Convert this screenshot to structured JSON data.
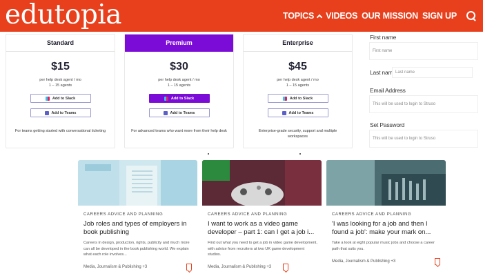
{
  "header": {
    "logo": "edutopia",
    "nav": {
      "topics": "TOPICS",
      "videos": "VIDEOS",
      "mission": "OUR MISSION",
      "signup": "SIGN UP"
    },
    "bg_color": "#e8401c"
  },
  "pricing": [
    {
      "name": "Standard",
      "price": "$15",
      "unit": "per help desk agent / mo",
      "agents": "1 – 15 agents",
      "slack": "Add to Slack",
      "teams": "Add to Teams",
      "desc": "For teams getting started with conversational ticketing"
    },
    {
      "name": "Premium",
      "price": "$30",
      "unit": "per help desk agent / mo",
      "agents": "1 – 15 agents",
      "slack": "Add to Slack",
      "teams": "Add to Teams",
      "desc": "For advanced teams who want more from their help desk"
    },
    {
      "name": "Enterprise",
      "price": "$45",
      "unit": "per help desk agent / mo",
      "agents": "1 – 15 agents",
      "slack": "Add to Slack",
      "teams": "Add to Teams",
      "desc": "Enterprise-grade security, support and multiple workspaces"
    }
  ],
  "form": {
    "first_name": {
      "label": "First name",
      "placeholder": "First name"
    },
    "last_name": {
      "label": "Last name",
      "placeholder": "Last name"
    },
    "email": {
      "label": "Email Address",
      "placeholder": "This will be used to login to Struso"
    },
    "password": {
      "label": "Set Password",
      "placeholder": "This will be used to login to Struso"
    }
  },
  "articles": [
    {
      "category": "CAREERS ADVICE AND PLANNING",
      "title": "Job roles and types of employers in book publishing",
      "excerpt": "Careers in design, production, rights, publicity and much more can all be developed in the book publishing world. We explain what each role involves...",
      "tags": "Media, Journalism & Publishing +3"
    },
    {
      "category": "CAREERS ADVICE AND PLANNING",
      "title": "I want to work as a video game developer – part 1: can I get a job i...",
      "excerpt": "Find out what you need to get a job in video game development, with advice from recruiters at two UK game development studios.",
      "tags": "Media, Journalism & Publishing +3"
    },
    {
      "category": "CAREERS ADVICE AND PLANNING",
      "title": "'I was looking for a job and then I found a job': make your mark on...",
      "excerpt": "Take a look at eight popular music jobs and choose a career path that suits you.",
      "tags": "Media, Journalism & Publishing +3"
    }
  ]
}
